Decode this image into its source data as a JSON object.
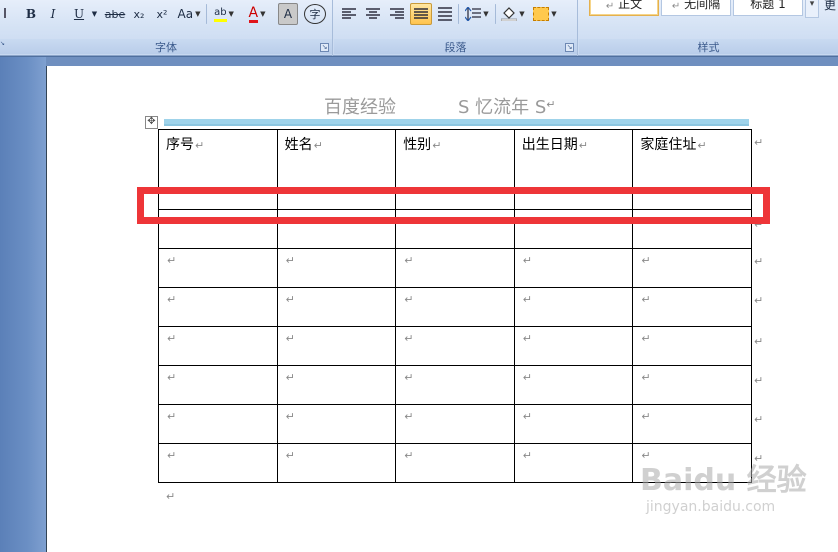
{
  "ribbon": {
    "groups": [
      {
        "label": "字体"
      },
      {
        "label": "段落"
      },
      {
        "label": "样式"
      }
    ],
    "font": {
      "bold": "B",
      "italic": "I",
      "underline": "U",
      "strike": "abe",
      "subscript": "x₂",
      "superscript": "x²",
      "change_case": "Aa",
      "highlight": "ab",
      "font_color": "A",
      "char_shading": "A",
      "enclose": "字"
    },
    "styles": {
      "items": [
        "正文",
        "无间隔",
        "标题 1"
      ],
      "more": "更"
    }
  },
  "document": {
    "header": {
      "title": "百度经验",
      "subtitle": "S 忆流年 S"
    },
    "paragraph_mark": "↵",
    "table": {
      "headers": [
        "序号",
        "姓名",
        "性别",
        "出生日期",
        "家庭住址"
      ],
      "empty_rows": 7
    }
  },
  "watermark": {
    "logo": "Baidu 经验",
    "url": "jingyan.baidu.com"
  },
  "colors": {
    "highlight": "#ee3538",
    "ribbon_bg": "#d6e3f5",
    "header_rule": "#9fd3ea"
  }
}
